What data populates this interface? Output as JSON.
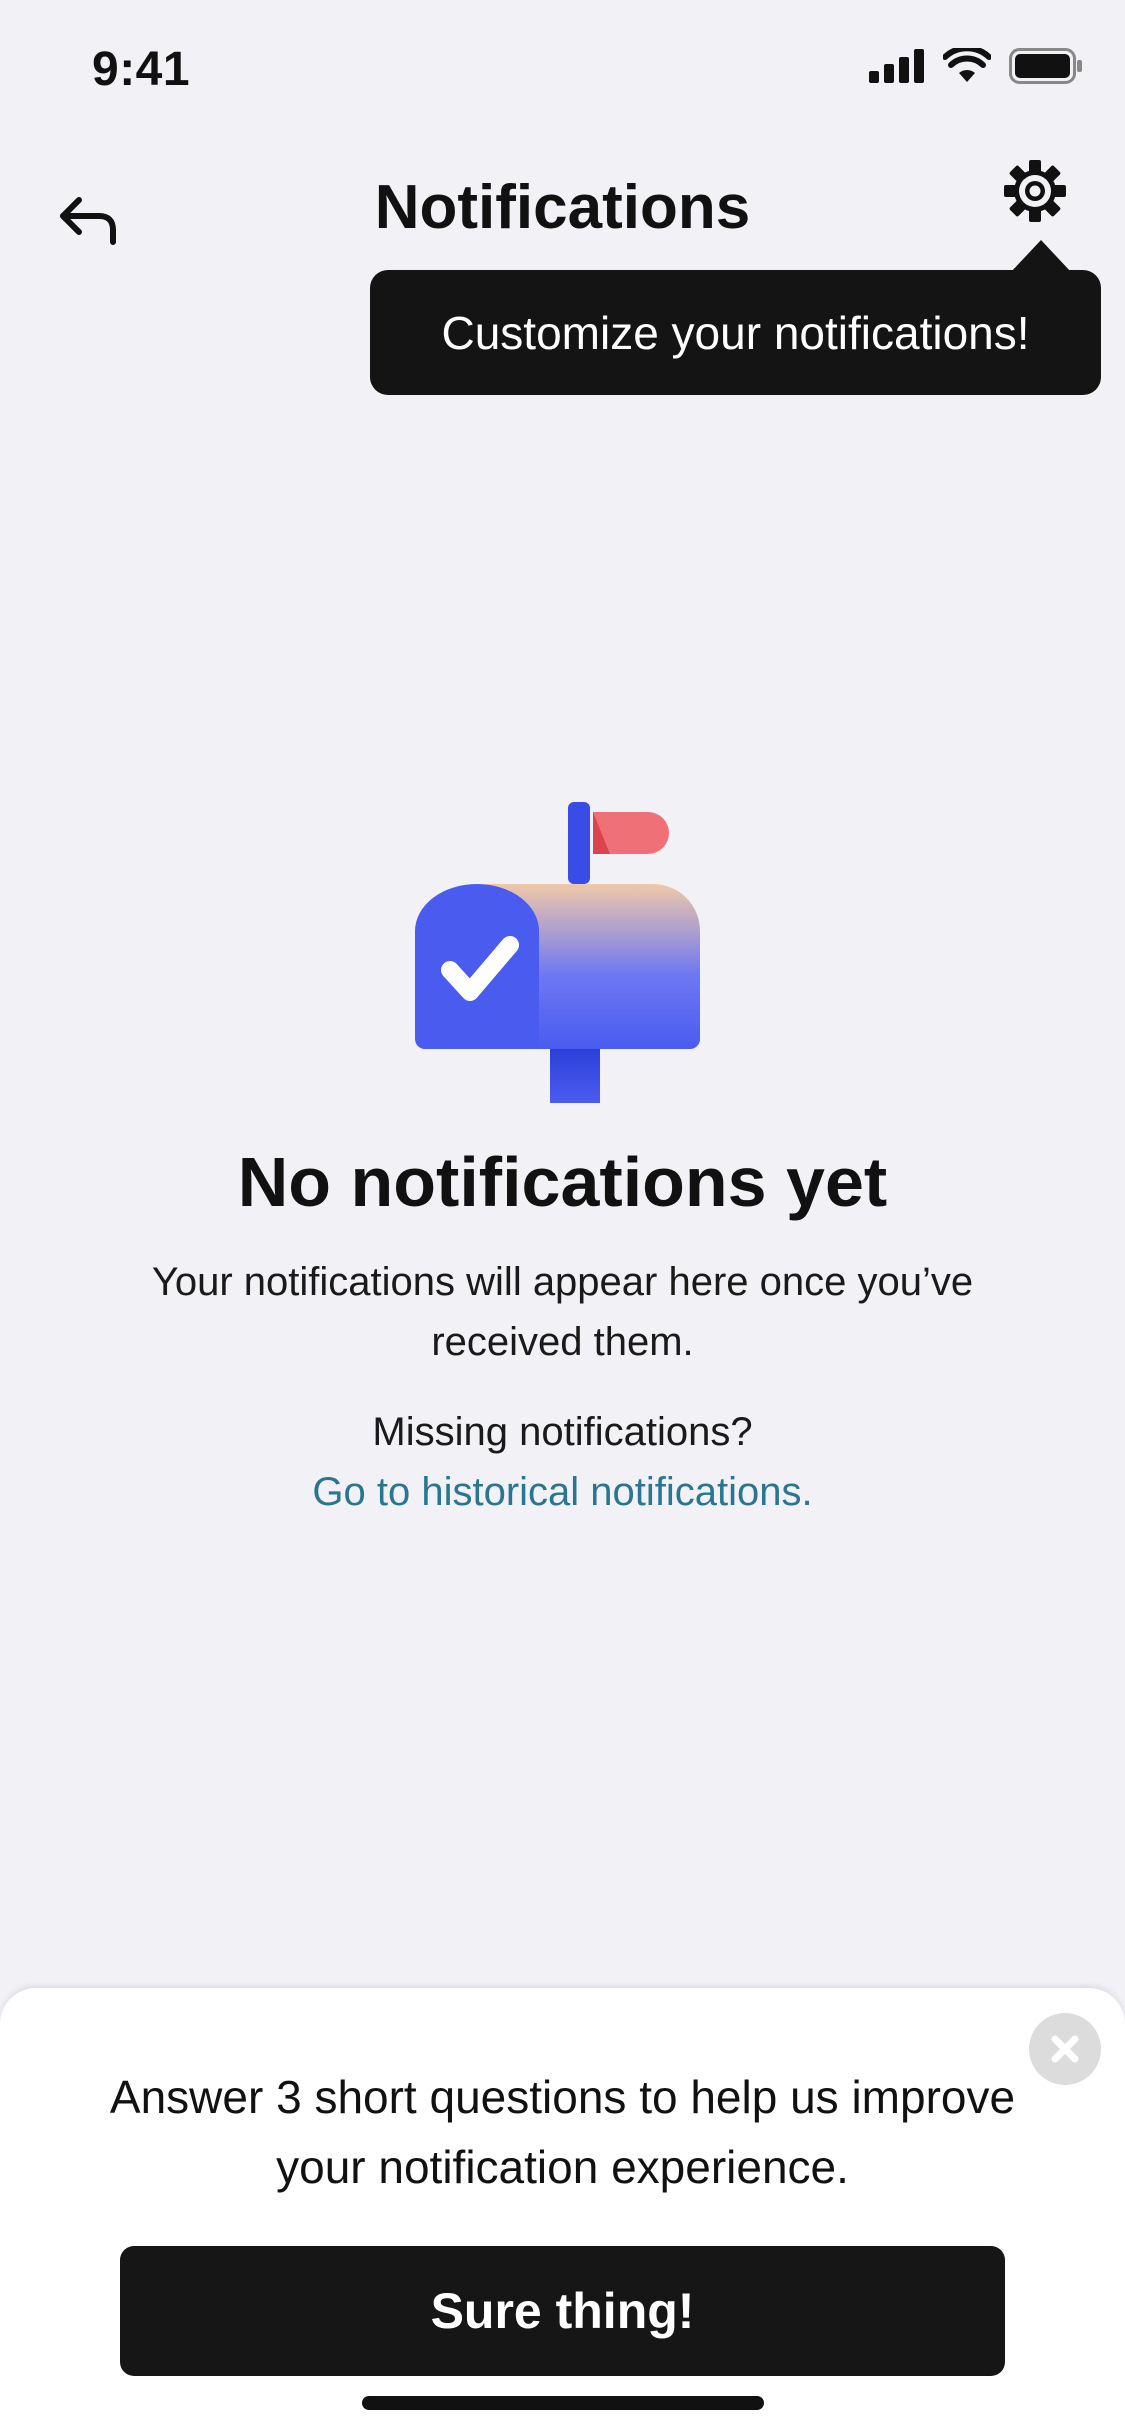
{
  "status_bar": {
    "time": "9:41",
    "icons": [
      "cellular-signal-icon",
      "wifi-icon",
      "battery-icon"
    ]
  },
  "nav": {
    "back_icon": "back-arrow-icon",
    "title": "Notifications",
    "settings_icon": "gear-icon"
  },
  "tooltip": {
    "text": "Customize your notifications!"
  },
  "empty_state": {
    "illustration": "mailbox-illustration",
    "title": "No notifications yet",
    "description": "Your notifications will appear here once you’ve received them.",
    "missing_label": "Missing notifications?",
    "historical_link": "Go to historical notifications."
  },
  "survey": {
    "text": "Answer 3 short questions to help us improve your notification experience.",
    "button_label": "Sure thing!",
    "close_icon": "close-icon"
  },
  "colors": {
    "background": "#f2f1f6",
    "tooltip_bg": "#141414",
    "link": "#2a7690",
    "mailbox_blue": "#4a5cf0",
    "flag_red": "#f06a72",
    "button_bg": "#161616"
  }
}
